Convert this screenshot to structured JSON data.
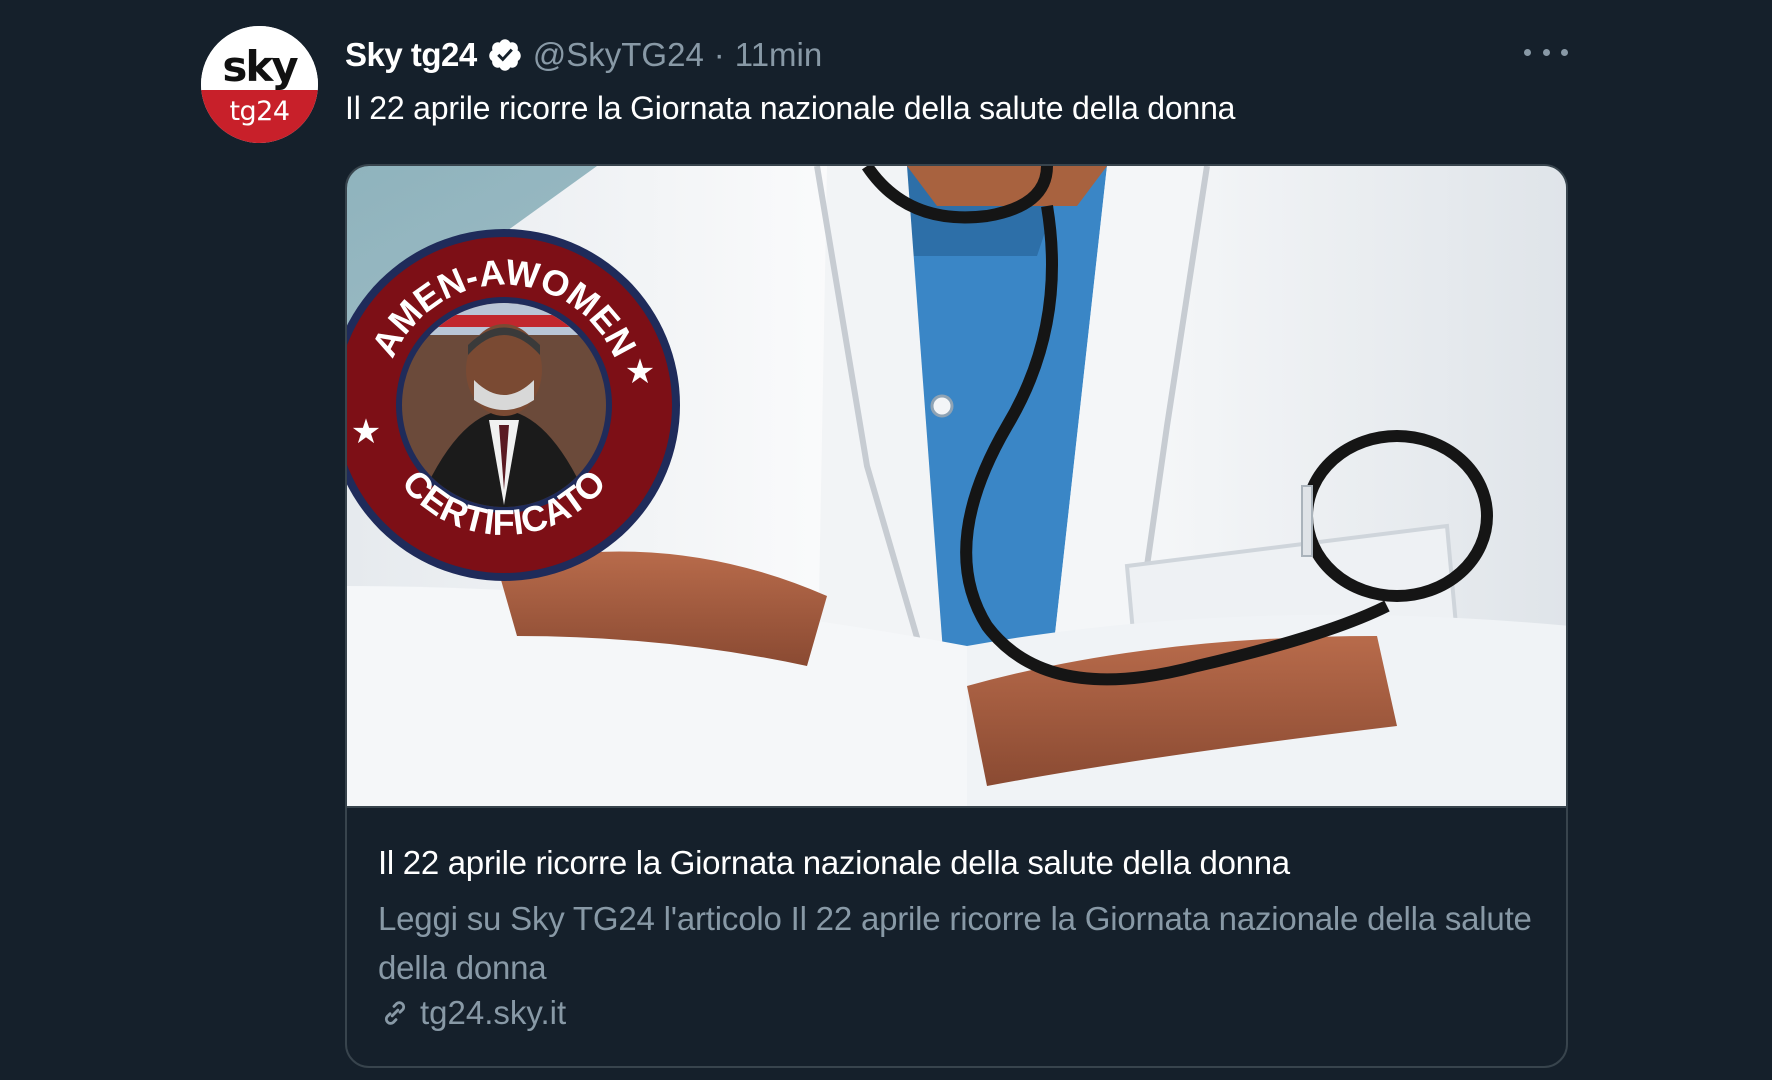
{
  "account": {
    "avatar_top": "sky",
    "avatar_bottom": "tg24",
    "display_name": "Sky tg24",
    "handle": "@SkyTG24",
    "separator": "·",
    "time": "11min"
  },
  "tweet": {
    "text": "Il 22 aprile ricorre la Giornata nazionale della salute della donna"
  },
  "card": {
    "title": "Il 22 aprile ricorre la Giornata nazionale della salute della donna",
    "description": "Leggi su Sky TG24 l'articolo Il 22 aprile ricorre la Giornata nazionale della salute della donna",
    "domain": "tg24.sky.it",
    "image_subject": "doctor in white coat with stethoscope, arms crossed"
  },
  "badge": {
    "top_text": "AMEN-AWOMEN",
    "bottom_text": "CERTIFICATO"
  },
  "colors": {
    "background": "#15202b",
    "secondary_text": "#8899a6",
    "border": "#38444d",
    "sky_red": "#c8202a",
    "badge_red": "#7d0f16",
    "badge_navy": "#1f2b5a"
  },
  "icons": {
    "verified": "verified-badge-icon",
    "more": "more-options-icon",
    "link": "link-icon"
  }
}
